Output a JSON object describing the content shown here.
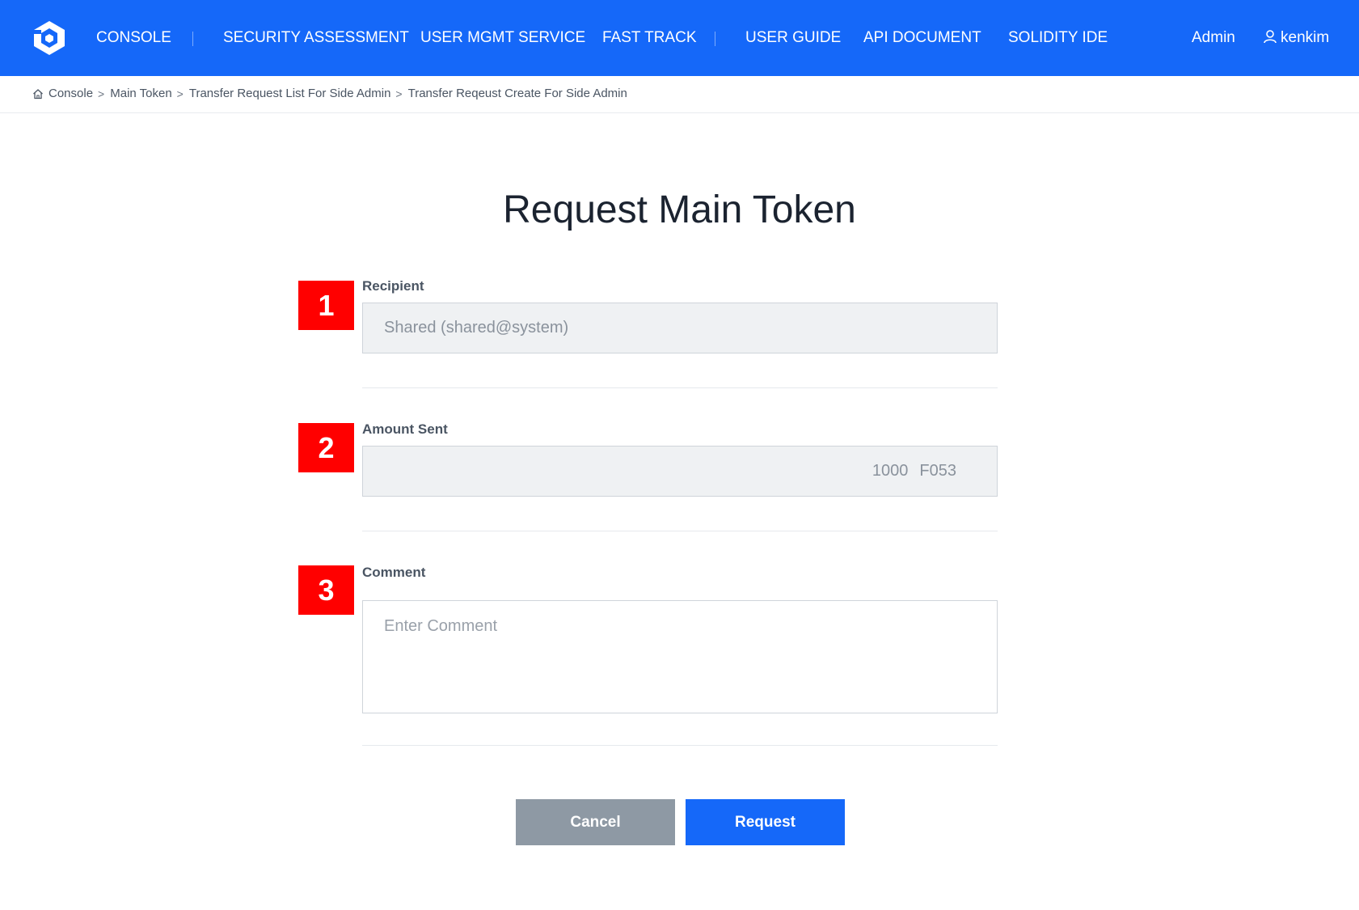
{
  "nav": {
    "links": [
      "CONSOLE",
      "SECURITY ASSESSMENT",
      "USER MGMT SERVICE",
      "FAST TRACK",
      "USER GUIDE",
      "API DOCUMENT",
      "SOLIDITY IDE"
    ],
    "admin": "Admin",
    "username": "kenkim"
  },
  "breadcrumb": {
    "items": [
      "Console",
      "Main Token",
      "Transfer Request List For Side Admin",
      "Transfer Reqeust Create For Side Admin"
    ],
    "separator": ">"
  },
  "page": {
    "title": "Request Main Token"
  },
  "steps": [
    "1",
    "2",
    "3"
  ],
  "form": {
    "recipient": {
      "label": "Recipient",
      "value": "Shared (shared@system)"
    },
    "amount": {
      "label": "Amount Sent",
      "value": "1000",
      "unit": "F053"
    },
    "comment": {
      "label": "Comment",
      "placeholder": "Enter Comment"
    }
  },
  "buttons": {
    "cancel": "Cancel",
    "request": "Request"
  },
  "colors": {
    "brand": "#1568f9",
    "badge": "#ff0000",
    "cancel": "#8e99a4"
  }
}
